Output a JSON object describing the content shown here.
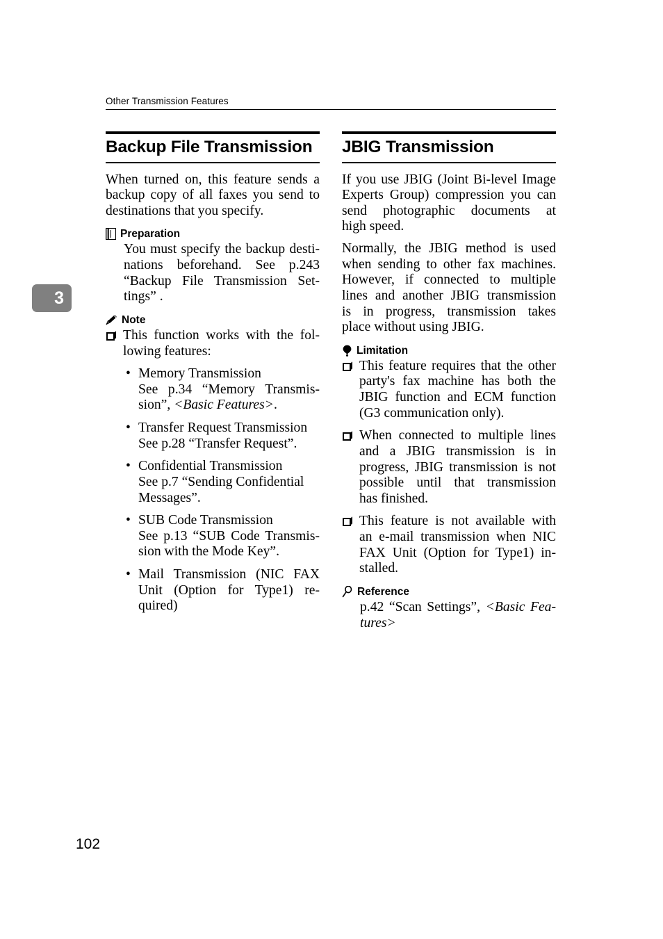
{
  "page": {
    "running_head": "Other Transmission Features",
    "chapter_tab": "3",
    "page_number": "102"
  },
  "left_column": {
    "heading": "Backup File Transmission",
    "intro_lines": [
      "When turned on, this feature sends a",
      "backup copy of all faxes you send to",
      "destinations that you specify."
    ],
    "preparation": {
      "icon": "book-icon",
      "label": "Preparation",
      "lines": [
        "You must specify the backup desti-",
        "nations beforehand. See p.243",
        "“Backup File Transmission Set-",
        "tings” ."
      ]
    },
    "note": {
      "icon": "pencil-icon",
      "label": "Note",
      "items": [
        {
          "lines": [
            "This function works with the fol-",
            "lowing features:"
          ]
        }
      ],
      "bullets": [
        {
          "line1": "Memory Transmission",
          "line2": "See p.34 “Memory Transmis-",
          "line3_plain": "sion”, ",
          "line3_italic": "<Basic Features>",
          "line3_tail": "."
        },
        {
          "line1": "Transfer Request Transmission",
          "line2": "See p.28 “Transfer Request”."
        },
        {
          "line1": "Confidential Transmission",
          "line2": "See p.7 “Sending Confidential",
          "line3": "Messages”."
        },
        {
          "line1": "SUB Code Transmission",
          "line2": "See p.13 “SUB Code Transmis-",
          "line3": "sion with the Mode Key”."
        },
        {
          "line1": "Mail Transmission (NIC FAX",
          "line2": "Unit (Option for Type1) re-",
          "line3": "quired)"
        }
      ]
    }
  },
  "right_column": {
    "heading": "JBIG Transmission",
    "paragraph_1_lines": [
      "If you use JBIG (Joint Bi-level Image",
      "Experts Group) compression you can",
      "send photographic documents at",
      "high speed."
    ],
    "paragraph_2_lines": [
      "Normally, the JBIG method is used",
      "when sending to other fax machines.",
      "However, if connected to multiple",
      "lines and another JBIG transmission",
      "is in progress, transmission takes",
      "place without using JBIG."
    ],
    "limitation": {
      "icon": "balloon-icon",
      "label": "Limitation",
      "items": [
        {
          "lines": [
            "This feature requires that the other",
            "party's fax machine has both the",
            "JBIG function and ECM function",
            "(G3 communication only)."
          ]
        },
        {
          "lines": [
            "When connected to multiple lines",
            "and a JBIG transmission is in",
            "progress, JBIG transmission is not",
            "possible until that transmission",
            "has finished."
          ]
        },
        {
          "lines": [
            "This feature is not available with",
            "an e-mail transmission when NIC",
            "FAX Unit (Option for Type1) in-",
            "stalled."
          ]
        }
      ]
    },
    "reference": {
      "icon": "magnifier-icon",
      "label": "Reference",
      "line1_plain": "p.42 “Scan Settings”, ",
      "line1_italic": "<Basic Fea-",
      "line2_italic": "tures>"
    }
  },
  "colors": {
    "tab_background": "#808080",
    "tab_text": "#ffffff",
    "rule": "#000000",
    "text": "#000000"
  }
}
